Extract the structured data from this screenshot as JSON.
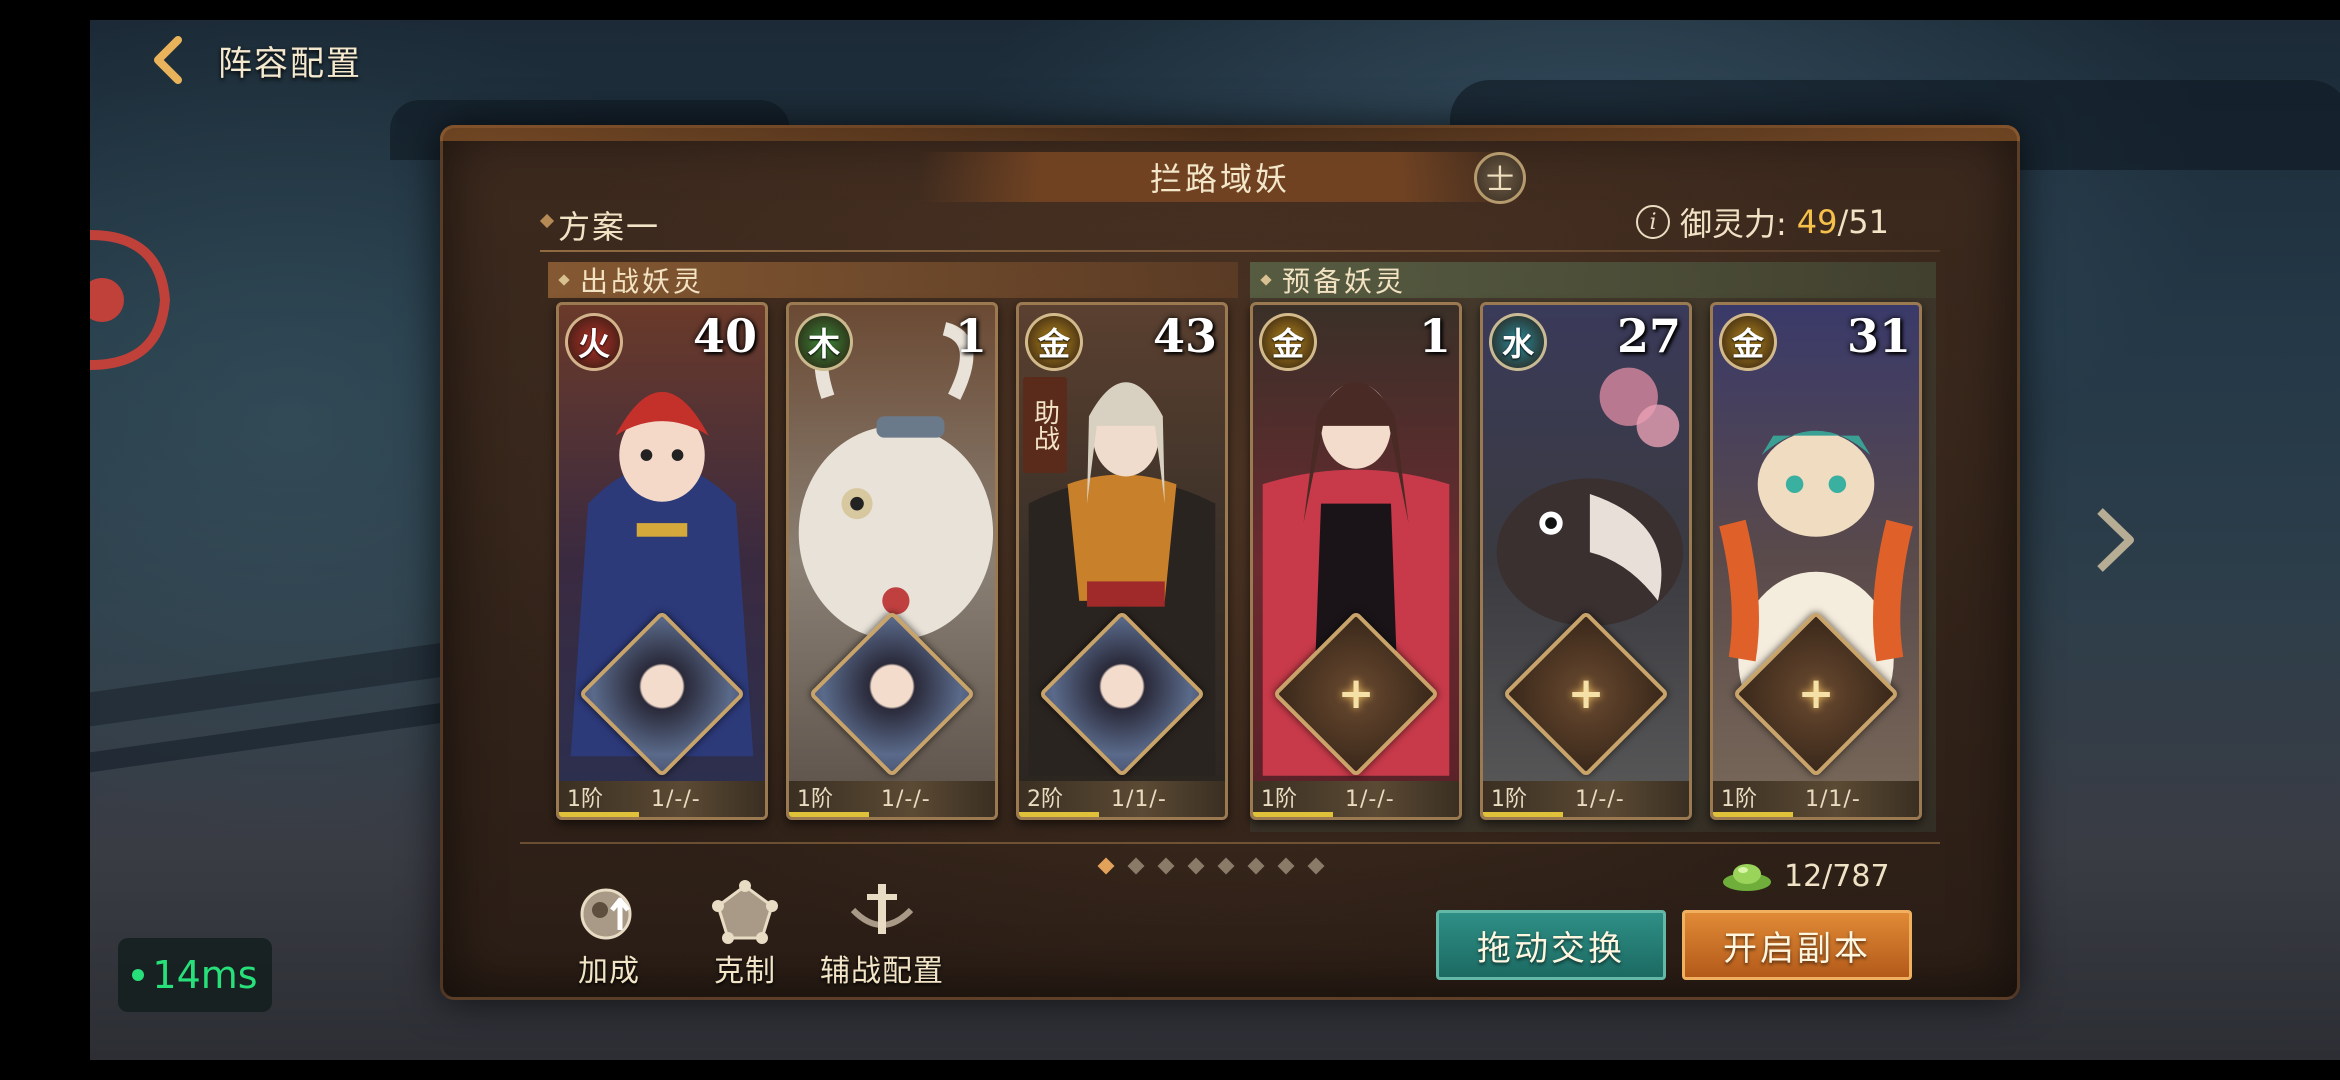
{
  "header": {
    "title": "阵容配置"
  },
  "stage": {
    "title": "拦路域妖",
    "badge": "士"
  },
  "plan": {
    "name": "方案一"
  },
  "power": {
    "label": "御灵力:",
    "current": "49",
    "separator": "/",
    "max": "51"
  },
  "sections": {
    "battle": "出战妖灵",
    "reserve": "预备妖灵"
  },
  "cards": [
    {
      "element": "火",
      "element_color": "#b3322a",
      "level": "40",
      "tier": "1阶",
      "stats": "1/-/-",
      "assist": "",
      "has_partner": true,
      "art": "red-cap-child"
    },
    {
      "element": "木",
      "element_color": "#3d8a3a",
      "level": "1",
      "tier": "1阶",
      "stats": "1/-/-",
      "assist": "",
      "has_partner": true,
      "art": "white-ox"
    },
    {
      "element": "金",
      "element_color": "#b88a1e",
      "level": "43",
      "tier": "2阶",
      "stats": "1/1/-",
      "assist": "助战",
      "has_partner": true,
      "art": "fur-robe-man"
    },
    {
      "element": "金",
      "element_color": "#b88a1e",
      "level": "1",
      "tier": "1阶",
      "stats": "1/-/-",
      "assist": "",
      "has_partner": false,
      "art": "red-robe-lady"
    },
    {
      "element": "水",
      "element_color": "#2a8a9a",
      "level": "27",
      "tier": "1阶",
      "stats": "1/-/-",
      "assist": "",
      "has_partner": false,
      "art": "koi-fish"
    },
    {
      "element": "金",
      "element_color": "#b88a1e",
      "level": "31",
      "tier": "1阶",
      "stats": "1/1/-",
      "assist": "",
      "has_partner": false,
      "art": "fox-cub"
    }
  ],
  "pager": {
    "count": 8,
    "active": 0
  },
  "resource": {
    "value": "12/787"
  },
  "tools": [
    {
      "label": "加成",
      "icon": "boost-icon"
    },
    {
      "label": "克制",
      "icon": "counter-icon"
    },
    {
      "label": "辅战配置",
      "icon": "support-config-icon"
    }
  ],
  "buttons": {
    "swap": "拖动交换",
    "start": "开启副本"
  },
  "ping": {
    "value": "14ms"
  },
  "colors": {
    "accent_gold": "#f6c14a",
    "swap_btn": "#2e8f86",
    "start_btn": "#e08a36",
    "ping": "#27e07a"
  }
}
